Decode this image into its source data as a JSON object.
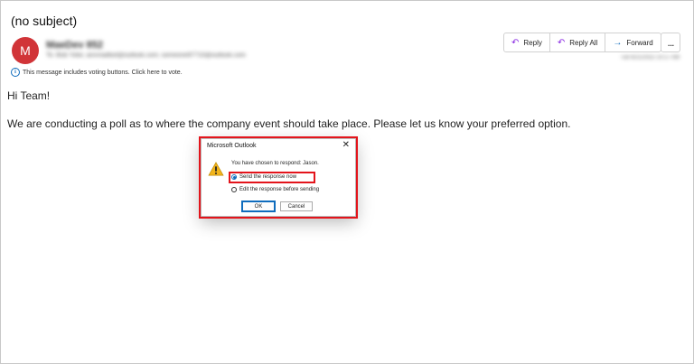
{
  "email": {
    "subject": "(no subject)",
    "avatar_initial": "M",
    "sender_name": "MaeDev 852",
    "to_line": "To: Bob Yoke; annmailbot@outlook.com; someone97710@outlook.com",
    "date": "Tue 6/21/2022 10:17 AM",
    "voting_notice": "This message includes voting buttons. Click here to vote.",
    "greeting": "Hi Team!",
    "body": "We are conducting a poll as to where the company event should take place. Please let us know your preferred option."
  },
  "toolbar": {
    "reply": "Reply",
    "reply_all": "Reply All",
    "forward": "Forward",
    "more": "..."
  },
  "dialog": {
    "title": "Microsoft Outlook",
    "close": "✕",
    "message": "You have chosen to respond: Jason.",
    "option_send": "Send the response now",
    "option_edit": "Edit the response before sending",
    "ok": "OK",
    "cancel": "Cancel",
    "selected_option": "send"
  },
  "colors": {
    "avatar": "#d13438",
    "highlight": "#e3141b",
    "accent": "#0f6cbd"
  },
  "icons": [
    "info-icon",
    "reply-icon",
    "reply-all-icon",
    "forward-icon",
    "more-icon",
    "warning-icon",
    "close-icon"
  ]
}
